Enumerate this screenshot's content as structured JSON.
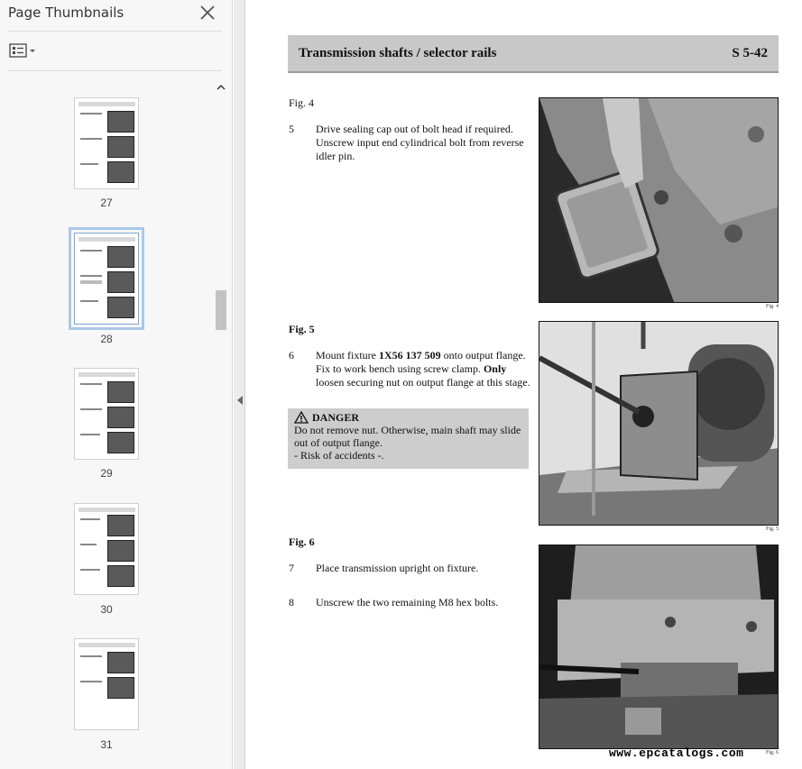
{
  "panel": {
    "title": "Page Thumbnails",
    "thumbnails": [
      {
        "label": "27"
      },
      {
        "label": "28"
      },
      {
        "label": "29"
      },
      {
        "label": "30"
      },
      {
        "label": "31"
      }
    ],
    "selected": "28"
  },
  "doc": {
    "header_title": "Transmission shafts / selector rails",
    "header_code": "S 5-42",
    "fig4": {
      "title": "Fig. 4",
      "caption": "Fig. 4",
      "step_num": "5",
      "step_text": "Drive sealing cap out of bolt head if required. Unscrew input end cylindrical bolt from reverse idler pin."
    },
    "fig5": {
      "title": "Fig. 5",
      "caption": "Fig. 5",
      "step_num": "6",
      "step_text_1": "Mount fixture ",
      "step_bold_1": "1X56 137 509",
      "step_text_2": " onto output flange. Fix to work bench using screw clamp. ",
      "step_bold_2": "Only",
      "step_text_3": " loosen securing nut on output flange at this stage."
    },
    "danger": {
      "heading": "DANGER",
      "line1": "Do not remove nut. Otherwise, main shaft may slide out of output flange.",
      "line2": "- Risk of accidents -."
    },
    "fig6": {
      "title": "Fig. 6",
      "caption": "Fig. 6",
      "step7_num": "7",
      "step7_text": "Place transmission upright on fixture.",
      "step8_num": "8",
      "step8_text": "Unscrew the two remaining M8 hex bolts."
    },
    "watermark": "www.epcatalogs.com"
  },
  "icons": {
    "close": "close-icon",
    "options": "list-options-icon",
    "danger": "warning-triangle-icon"
  },
  "colors": {
    "header_bar": "#c8c8c8",
    "danger_box": "#cdcdcd",
    "selected_outline": "#a9c8e8"
  }
}
